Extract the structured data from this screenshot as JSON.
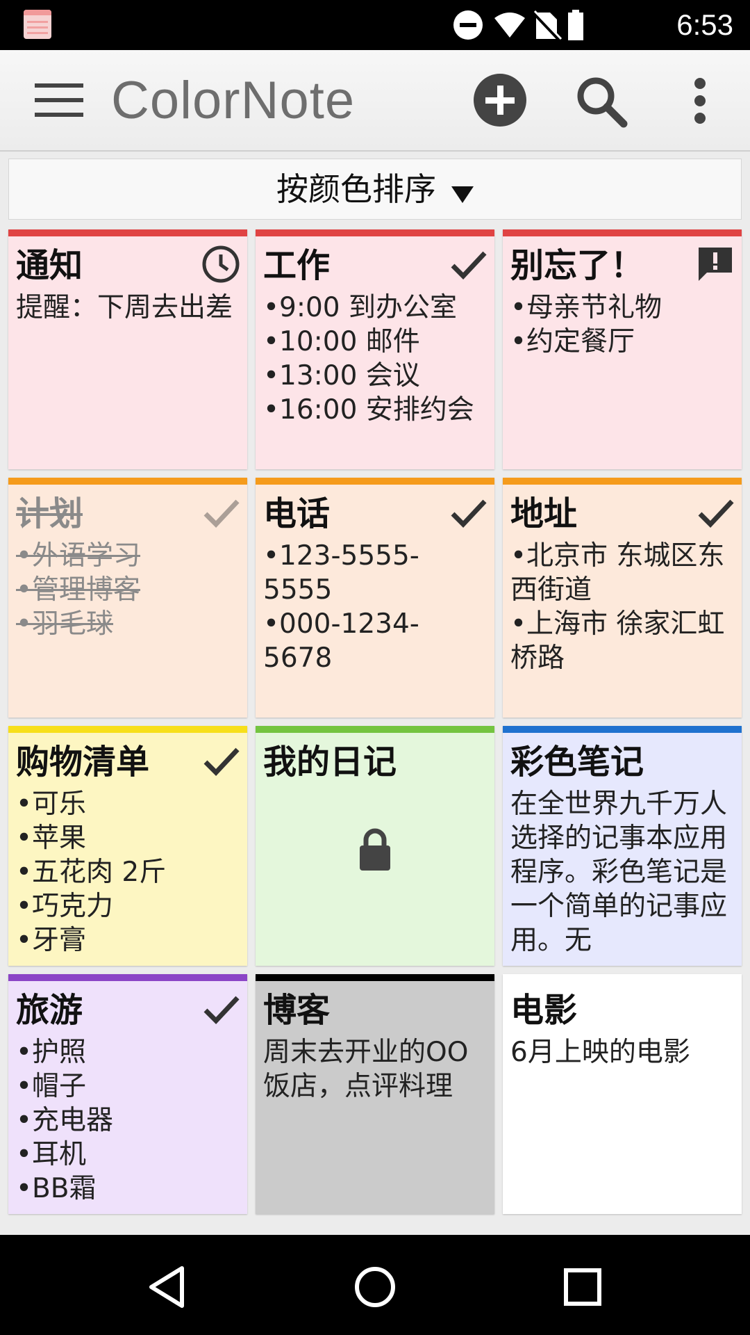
{
  "status_bar": {
    "time": "6:53"
  },
  "app_bar": {
    "title": "ColorNote"
  },
  "sort_bar": {
    "label": "按颜色排序"
  },
  "notes": [
    {
      "title": "通知",
      "color": "#e0e0e0",
      "bg": "#fde4e8",
      "stripe": "#e04343",
      "icon": "clock-icon",
      "done": false,
      "lines": [
        "提醒：下周去出差"
      ]
    },
    {
      "title": "工作",
      "bg": "#fde4e8",
      "stripe": "#e04343",
      "icon": "check-icon",
      "done": false,
      "lines": [
        "•9:00 到办公室",
        "•10:00 邮件",
        "•13:00 会议",
        "•16:00 安排约会"
      ]
    },
    {
      "title": "别忘了！",
      "bg": "#fde4e8",
      "stripe": "#e04343",
      "icon": "alert-icon",
      "done": false,
      "lines": [
        "•母亲节礼物",
        "•约定餐厅"
      ]
    },
    {
      "title": "计划",
      "bg": "#fde9db",
      "stripe": "#f59b1b",
      "icon": "check-icon",
      "done": true,
      "lines": [
        "•外语学习",
        "•管理博客",
        "•羽毛球"
      ]
    },
    {
      "title": "电话",
      "bg": "#fde9db",
      "stripe": "#f59b1b",
      "icon": "check-icon",
      "done": false,
      "lines": [
        "•123-5555-5555",
        "•000-1234-5678"
      ]
    },
    {
      "title": "地址",
      "bg": "#fde9db",
      "stripe": "#f59b1b",
      "icon": "check-icon",
      "done": false,
      "lines": [
        "•北京市 东城区东西街道",
        "•上海市 徐家汇虹桥路"
      ]
    },
    {
      "title": "购物清单",
      "bg": "#fdf6c2",
      "stripe": "#f7df1b",
      "icon": "check-icon",
      "done": false,
      "lines": [
        "•可乐",
        "•苹果",
        "•五花肉 2斤",
        "•巧克力",
        "•牙膏"
      ]
    },
    {
      "title": "我的日记",
      "bg": "#e4f7dc",
      "stripe": "#74c440",
      "icon": "none",
      "locked": true,
      "done": false,
      "lines": []
    },
    {
      "title": "彩色笔记",
      "bg": "#e6e8fd",
      "stripe": "#1f72cf",
      "icon": "none",
      "done": false,
      "lines": [
        "在全世界九千万人选择的记事本应用程序。彩色笔记是一个简单的记事应用。无"
      ]
    },
    {
      "title": "旅游",
      "bg": "#efe1fb",
      "stripe": "#8b45c6",
      "icon": "check-icon",
      "done": false,
      "lines": [
        "•护照",
        "•帽子",
        "•充电器",
        "•耳机",
        "•BB霜"
      ]
    },
    {
      "title": "博客",
      "bg": "#cbcbcb",
      "stripe": "#000000",
      "icon": "none",
      "done": false,
      "lines": [
        "周末去开业的OO饭店，点评料理"
      ]
    },
    {
      "title": "电影",
      "bg": "#ffffff",
      "stripe": "#ffffff",
      "icon": "none",
      "done": false,
      "lines": [
        "6月上映的电影"
      ]
    }
  ]
}
